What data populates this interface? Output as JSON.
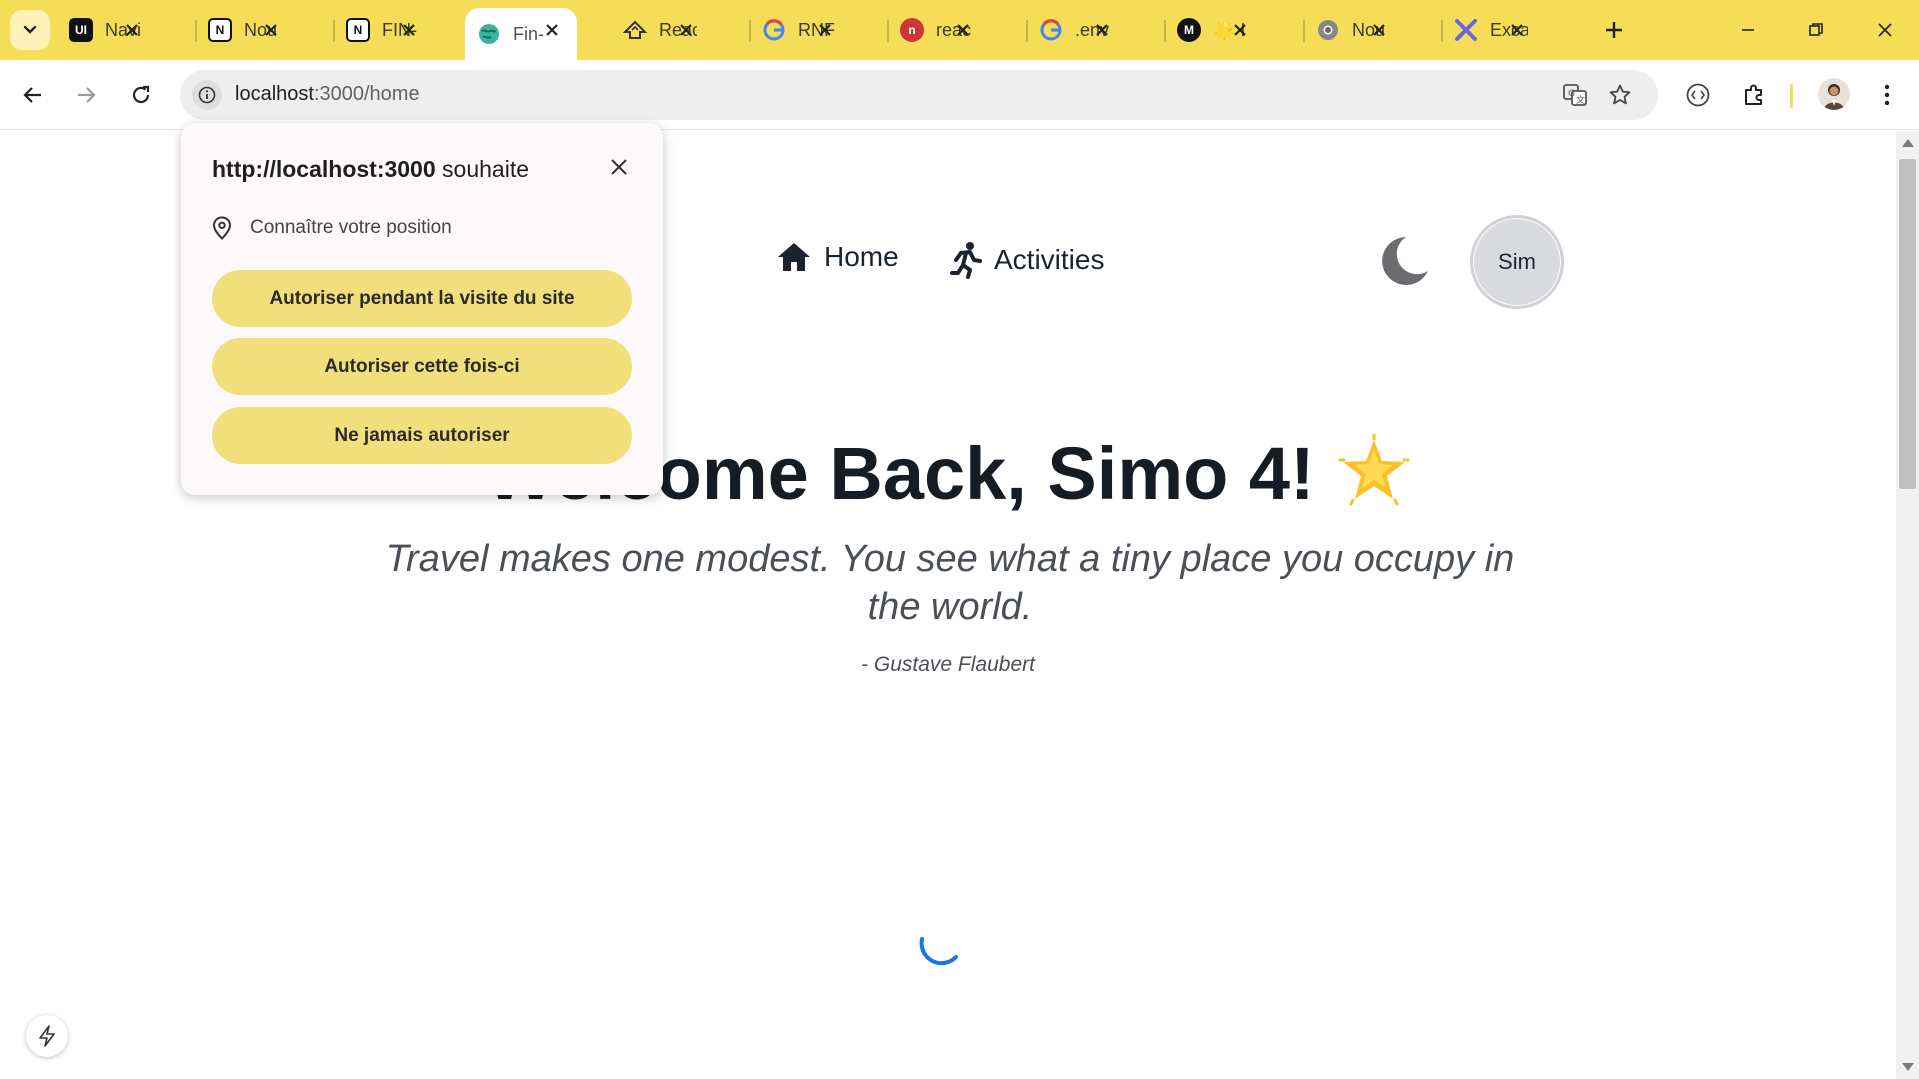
{
  "browser": {
    "tabs": [
      {
        "title": "Navi",
        "favicon": "UI",
        "icon": "ui-icon",
        "fav_bg": "#111111",
        "fav_fg": "#ffffff",
        "active": false
      },
      {
        "title": "Nou",
        "favicon": "N",
        "icon": "notion-icon",
        "fav_bg": "#ffffff",
        "fav_fg": "#111111",
        "active": false
      },
      {
        "title": "FIN-",
        "favicon": "N",
        "icon": "notion-icon",
        "fav_bg": "#ffffff",
        "fav_fg": "#111111",
        "active": false
      },
      {
        "title": "Fin-",
        "favicon": "",
        "icon": "globe-icon",
        "fav_bg": "#3bb0a6",
        "fav_fg": "#ffffff",
        "active": true
      },
      {
        "title": "Reac",
        "favicon": "",
        "icon": "reader-icon",
        "fav_bg": "#f6dd58",
        "fav_fg": "#333333",
        "active": false
      },
      {
        "title": "RNF",
        "favicon": "G",
        "icon": "google-icon",
        "fav_bg": "#ffffff",
        "fav_fg": "#4285f4",
        "active": false
      },
      {
        "title": "reac",
        "favicon": "n",
        "icon": "npm-icon",
        "fav_bg": "#cb3837",
        "fav_fg": "#ffffff",
        "active": false
      },
      {
        "title": ".env",
        "favicon": "G",
        "icon": "google-icon",
        "fav_bg": "#ffffff",
        "fav_fg": "#4285f4",
        "active": false
      },
      {
        "title": "🌟 I",
        "favicon": "M",
        "icon": "medium-icon",
        "fav_bg": "#111111",
        "fav_fg": "#ffffff",
        "active": false
      },
      {
        "title": "Nou",
        "favicon": "",
        "icon": "chrome-icon",
        "fav_bg": "#777777",
        "fav_fg": "#ffffff",
        "active": false
      },
      {
        "title": "Exca",
        "favicon": "",
        "icon": "excalidraw-icon",
        "fav_bg": "#6965db",
        "fav_fg": "#ffffff",
        "active": false
      }
    ],
    "url_host": "localhost",
    "url_path": ":3000/home"
  },
  "popup": {
    "origin": "http://localhost:3000",
    "title_suffix": " souhaite",
    "permission": "Connaître votre position",
    "buttons": [
      "Autoriser pendant la visite du site",
      "Autoriser cette fois-ci",
      "Ne jamais autoriser"
    ]
  },
  "nav": {
    "home": "Home",
    "activities": "Activities",
    "avatar": "Sim"
  },
  "hero": {
    "welcome": "Welcome Back, Simo 4!",
    "quote": "Travel makes one modest. You see what a tiny place you occupy in the world.",
    "author": "- Gustave Flaubert"
  },
  "colors": {
    "chrome_accent": "#f6dd58",
    "popup_button": "#f0df7a",
    "spinner": "#1a73e8"
  }
}
